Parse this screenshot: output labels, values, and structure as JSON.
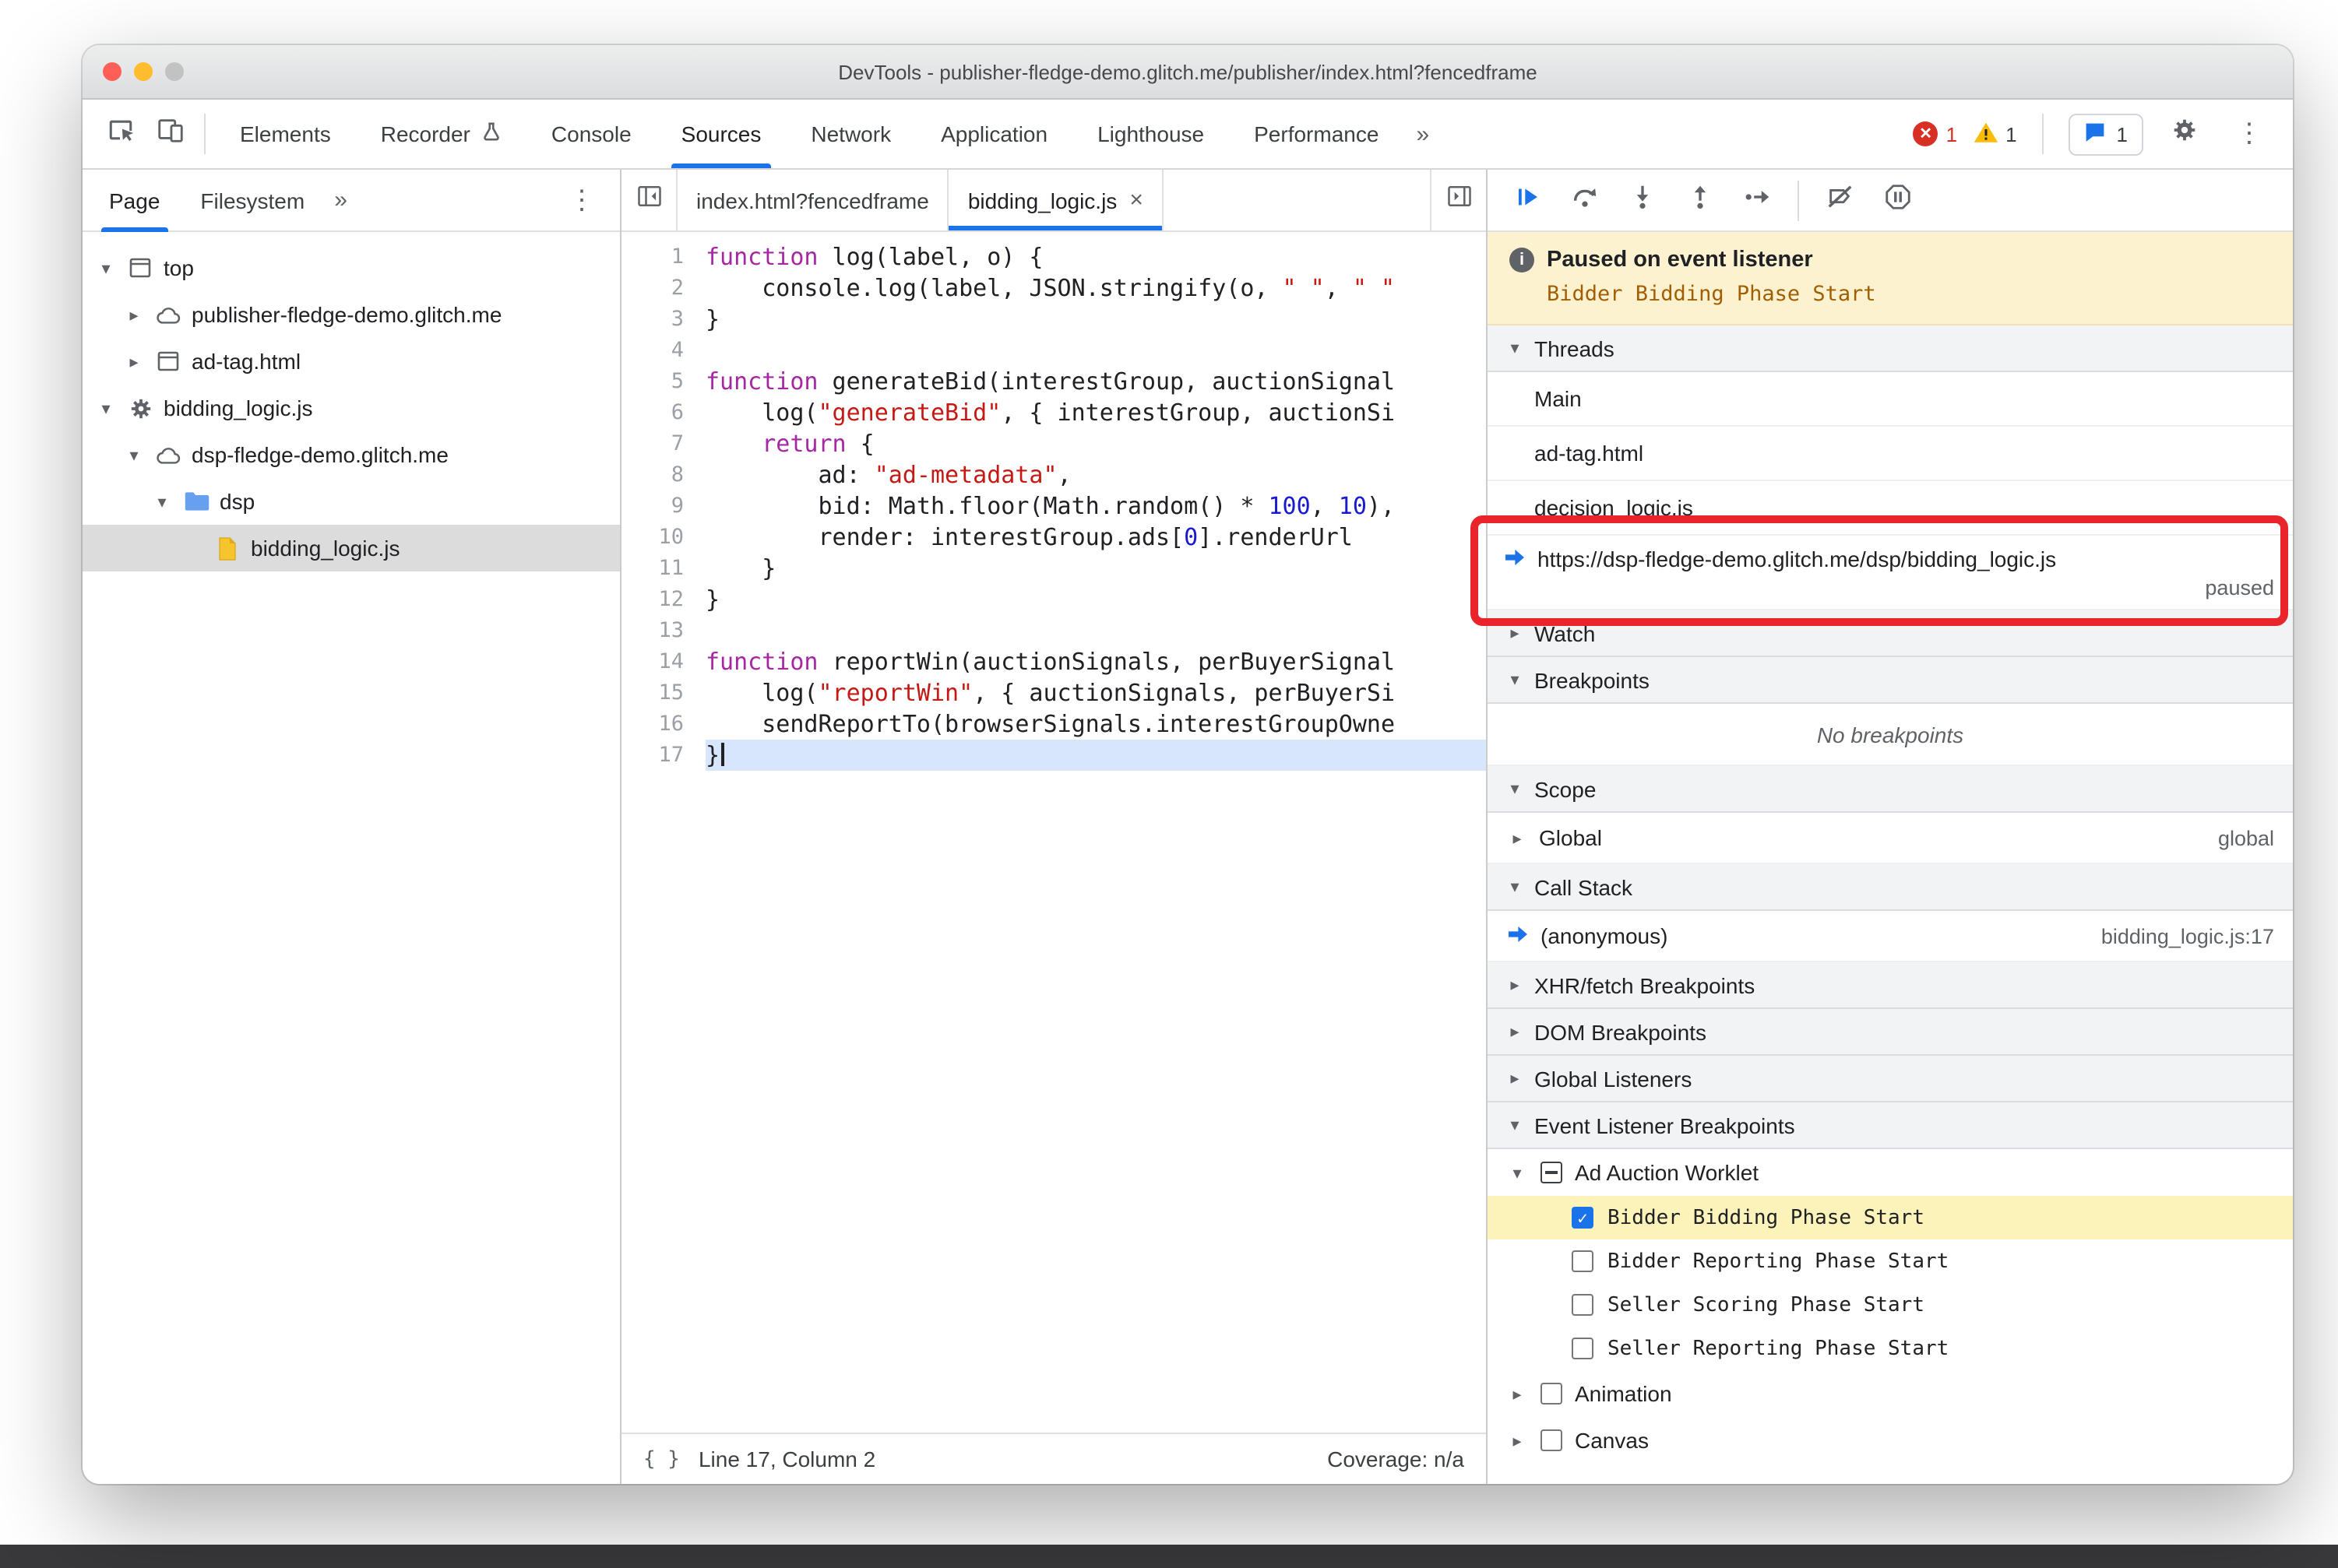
{
  "colors": {
    "accent_blue": "#1a73e8",
    "annotation_red": "#e9242a",
    "paused_banner_bg": "#fdf2d0",
    "current_line_bg": "#d7e6fc",
    "breakpoint_highlight_bg": "#fcf3bb",
    "selected_tree_row_bg": "#dcdcdc"
  },
  "icons": {
    "disclosure_open": "▾",
    "disclosure_closed": "▸",
    "overflow_chevron": "»",
    "kebab": "⋮",
    "close": "×",
    "braces": "{ }",
    "info": "i",
    "error_x": "✕"
  },
  "named_svg_icons": [
    "inspect-icon",
    "device-toolbar-icon",
    "flask-icon",
    "settings-gear-icon",
    "frame-icon",
    "cloud-icon",
    "worker-gear-icon",
    "folder-icon",
    "js-file-icon",
    "hide-navigator-icon",
    "show-editors-icon",
    "resume-icon",
    "step-over-icon",
    "step-into-icon",
    "step-out-icon",
    "step-icon",
    "deactivate-breakpoints-icon",
    "pause-on-exceptions-icon",
    "execution-arrow-icon",
    "error-icon",
    "warning-icon",
    "issues-bubble-icon",
    "info-icon"
  ],
  "window": {
    "title": "DevTools - publisher-fledge-demo.glitch.me/publisher/index.html?fencedframe"
  },
  "toolbar": {
    "tabs": [
      {
        "label": "Elements",
        "active": false
      },
      {
        "label": "Recorder",
        "active": false,
        "badge": "flask-icon"
      },
      {
        "label": "Console",
        "active": false
      },
      {
        "label": "Sources",
        "active": true
      },
      {
        "label": "Network",
        "active": false
      },
      {
        "label": "Application",
        "active": false
      },
      {
        "label": "Lighthouse",
        "active": false
      },
      {
        "label": "Performance",
        "active": false
      }
    ],
    "error_count": "1",
    "warning_count": "1",
    "issues_count": "1"
  },
  "navigator": {
    "tabs": [
      {
        "label": "Page",
        "active": true
      },
      {
        "label": "Filesystem",
        "active": false
      }
    ],
    "tree": [
      {
        "label": "top",
        "icon": "frame-icon",
        "depth": 0,
        "expanded": true
      },
      {
        "label": "publisher-fledge-demo.glitch.me",
        "icon": "cloud-icon",
        "depth": 1,
        "expanded": false
      },
      {
        "label": "ad-tag.html",
        "icon": "frame-icon",
        "depth": 1,
        "expanded": false
      },
      {
        "label": "bidding_logic.js",
        "icon": "worker-gear-icon",
        "depth": 0,
        "expanded": true
      },
      {
        "label": "dsp-fledge-demo.glitch.me",
        "icon": "cloud-icon",
        "depth": 1,
        "expanded": true
      },
      {
        "label": "dsp",
        "icon": "folder-icon",
        "depth": 2,
        "expanded": true
      },
      {
        "label": "bidding_logic.js",
        "icon": "js-file-icon",
        "depth": 3,
        "selected": true
      }
    ]
  },
  "editor": {
    "tabs": [
      {
        "label": "index.html?fencedframe",
        "active": false,
        "closable": false
      },
      {
        "label": "bidding_logic.js",
        "active": true,
        "closable": true
      }
    ],
    "code": {
      "lines": [
        {
          "tokens": [
            {
              "c": "k",
              "t": "function"
            },
            {
              "c": "",
              "t": " log(label, o) {"
            }
          ]
        },
        {
          "tokens": [
            {
              "c": "",
              "t": "    console.log(label, JSON.stringify(o, "
            },
            {
              "c": "s",
              "t": "\" \""
            },
            {
              "c": "",
              "t": ", "
            },
            {
              "c": "s",
              "t": "\" \""
            }
          ]
        },
        {
          "tokens": [
            {
              "c": "",
              "t": "}"
            }
          ]
        },
        {
          "tokens": []
        },
        {
          "tokens": [
            {
              "c": "k",
              "t": "function"
            },
            {
              "c": "",
              "t": " generateBid(interestGroup, auctionSignal"
            }
          ]
        },
        {
          "tokens": [
            {
              "c": "",
              "t": "    log("
            },
            {
              "c": "s",
              "t": "\"generateBid\""
            },
            {
              "c": "",
              "t": ", { interestGroup, auctionSi"
            }
          ]
        },
        {
          "tokens": [
            {
              "c": "",
              "t": "    "
            },
            {
              "c": "k",
              "t": "return"
            },
            {
              "c": "",
              "t": " {"
            }
          ]
        },
        {
          "tokens": [
            {
              "c": "",
              "t": "        ad: "
            },
            {
              "c": "s",
              "t": "\"ad-metadata\""
            },
            {
              "c": "",
              "t": ","
            }
          ]
        },
        {
          "tokens": [
            {
              "c": "",
              "t": "        bid: Math.floor(Math.random() * "
            },
            {
              "c": "n",
              "t": "100"
            },
            {
              "c": "",
              "t": ", "
            },
            {
              "c": "n",
              "t": "10"
            },
            {
              "c": "",
              "t": "),"
            }
          ]
        },
        {
          "tokens": [
            {
              "c": "",
              "t": "        render: interestGroup.ads["
            },
            {
              "c": "n",
              "t": "0"
            },
            {
              "c": "",
              "t": "].renderUrl"
            }
          ]
        },
        {
          "tokens": [
            {
              "c": "",
              "t": "    }"
            }
          ]
        },
        {
          "tokens": [
            {
              "c": "",
              "t": "}"
            }
          ]
        },
        {
          "tokens": []
        },
        {
          "tokens": [
            {
              "c": "k",
              "t": "function"
            },
            {
              "c": "",
              "t": " reportWin(auctionSignals, perBuyerSignal"
            }
          ]
        },
        {
          "tokens": [
            {
              "c": "",
              "t": "    log("
            },
            {
              "c": "s",
              "t": "\"reportWin\""
            },
            {
              "c": "",
              "t": ", { auctionSignals, perBuyerSi"
            }
          ]
        },
        {
          "tokens": [
            {
              "c": "",
              "t": "    sendReportTo(browserSignals.interestGroupOwne"
            }
          ]
        },
        {
          "tokens": [
            {
              "c": "",
              "t": "}"
            }
          ],
          "current": true,
          "caret": true
        }
      ]
    },
    "status": {
      "line_col": "Line 17, Column 2",
      "coverage": "Coverage: n/a"
    }
  },
  "debugger": {
    "paused_banner": {
      "title": "Paused on event listener",
      "detail": "Bidder Bidding Phase Start"
    },
    "threads": {
      "title": "Threads",
      "items": [
        {
          "label": "Main"
        },
        {
          "label": "ad-tag.html"
        },
        {
          "label": "decision_logic.js"
        },
        {
          "label": "https://dsp-fledge-demo.glitch.me/dsp/bidding_logic.js",
          "status": "paused",
          "current": true
        }
      ]
    },
    "watch": {
      "title": "Watch",
      "expanded": false
    },
    "breakpoints": {
      "title": "Breakpoints",
      "expanded": true,
      "empty": "No breakpoints"
    },
    "scope": {
      "title": "Scope",
      "expanded": true,
      "rows": [
        {
          "label": "Global",
          "value": "global"
        }
      ]
    },
    "call_stack": {
      "title": "Call Stack",
      "expanded": true,
      "frames": [
        {
          "label": "(anonymous)",
          "location": "bidding_logic.js:17",
          "current": true
        }
      ]
    },
    "xhr": {
      "title": "XHR/fetch Breakpoints",
      "expanded": false
    },
    "dom": {
      "title": "DOM Breakpoints",
      "expanded": false
    },
    "global_listeners": {
      "title": "Global Listeners",
      "expanded": false
    },
    "event_listener_breakpoints": {
      "title": "Event Listener Breakpoints",
      "expanded": true,
      "groups": [
        {
          "label": "Ad Auction Worklet",
          "state": "indeterminate",
          "expanded": true,
          "children": [
            {
              "label": "Bidder Bidding Phase Start",
              "checked": true,
              "highlighted": true
            },
            {
              "label": "Bidder Reporting Phase Start",
              "checked": false
            },
            {
              "label": "Seller Scoring Phase Start",
              "checked": false
            },
            {
              "label": "Seller Reporting Phase Start",
              "checked": false
            }
          ]
        },
        {
          "label": "Animation",
          "state": "unchecked",
          "expanded": false,
          "children": []
        },
        {
          "label": "Canvas",
          "state": "unchecked",
          "expanded": false,
          "children": []
        }
      ]
    }
  }
}
